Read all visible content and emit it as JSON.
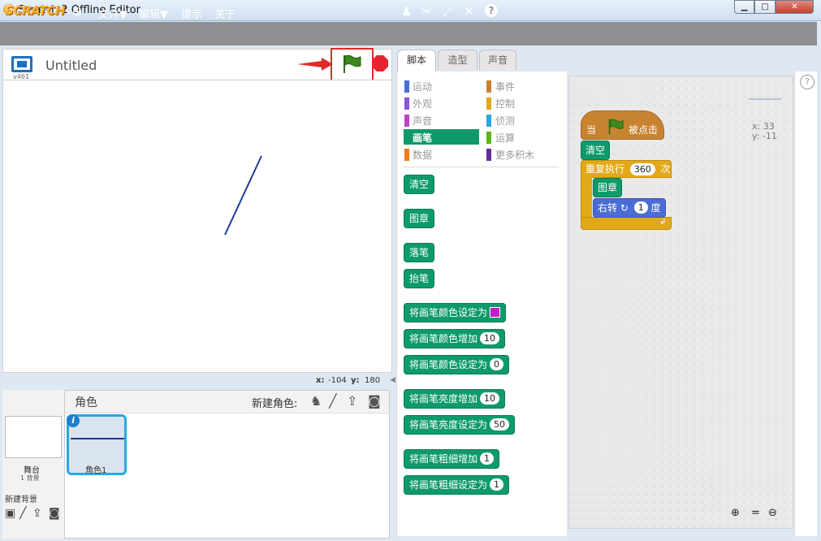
{
  "window": {
    "title": "Scratch 2 Offline Editor",
    "icon": "scratch-cat-icon",
    "minimize": "▁",
    "maximize": "□",
    "close": "✕"
  },
  "menubar": {
    "logo": "SCRATCH",
    "items": [
      "文件▼",
      "编辑▼",
      "提示",
      "关于"
    ],
    "tools": [
      "duplicate-stamp-icon",
      "delete-scissors-icon",
      "grow-icon",
      "shrink-icon",
      "help-icon"
    ],
    "help": "?"
  },
  "stage": {
    "title": "Untitled",
    "version": "v461",
    "x_label": "x:",
    "x_value": "-104",
    "y_label": "y:",
    "y_value": "180"
  },
  "tabs": [
    "脚本",
    "造型",
    "声音"
  ],
  "categories": {
    "left": [
      {
        "label": "运动",
        "color": "#4a6cd4"
      },
      {
        "label": "外观",
        "color": "#8a55d7"
      },
      {
        "label": "声音",
        "color": "#bb42c3"
      },
      {
        "label": "画笔",
        "color": "#0e9a6c"
      },
      {
        "label": "数据",
        "color": "#ee7d16"
      }
    ],
    "right": [
      {
        "label": "事件",
        "color": "#c88330"
      },
      {
        "label": "控制",
        "color": "#e1a91a"
      },
      {
        "label": "侦测",
        "color": "#2ca5e2"
      },
      {
        "label": "运算",
        "color": "#5cb712"
      },
      {
        "label": "更多积木",
        "color": "#632d99"
      }
    ]
  },
  "palette_blocks": [
    {
      "label": "清空"
    },
    {
      "label": "图章"
    },
    {
      "label": "落笔"
    },
    {
      "label": "抬笔"
    },
    {
      "label": "将画笔颜色设定为",
      "swatch": "#c31fc9"
    },
    {
      "label": "将画笔颜色增加",
      "value": "10"
    },
    {
      "label": "将画笔颜色设定为",
      "value": "0"
    },
    {
      "label": "将画笔亮度增加",
      "value": "10"
    },
    {
      "label": "将画笔亮度设定为",
      "value": "50"
    },
    {
      "label": "将画笔粗细增加",
      "value": "1"
    },
    {
      "label": "将画笔粗细设定为",
      "value": "1"
    }
  ],
  "script": {
    "hat_prefix": "当",
    "hat_suffix": "被点击",
    "clear": "清空",
    "repeat_label": "重复执行",
    "repeat_value": "360",
    "repeat_unit": "次",
    "stamp": "图章",
    "turn_label": "右转",
    "turn_value": "1",
    "turn_unit": "度",
    "sprite_x": "x: 33",
    "sprite_y": "y: -11"
  },
  "sprites": {
    "header": "角色",
    "new_sprite": "新建角色:",
    "stage_label": "舞台",
    "stage_backdrops": "1 背景",
    "new_backdrop": "新建背景",
    "sprite_name": "角色1",
    "info": "i"
  },
  "colors": {
    "pen_line": "#1a3c9e",
    "events": "#c88330",
    "control": "#e1a91a",
    "pen": "#0e9a6c",
    "motion": "#4a6cd4",
    "highlight": "#e02a2a"
  }
}
